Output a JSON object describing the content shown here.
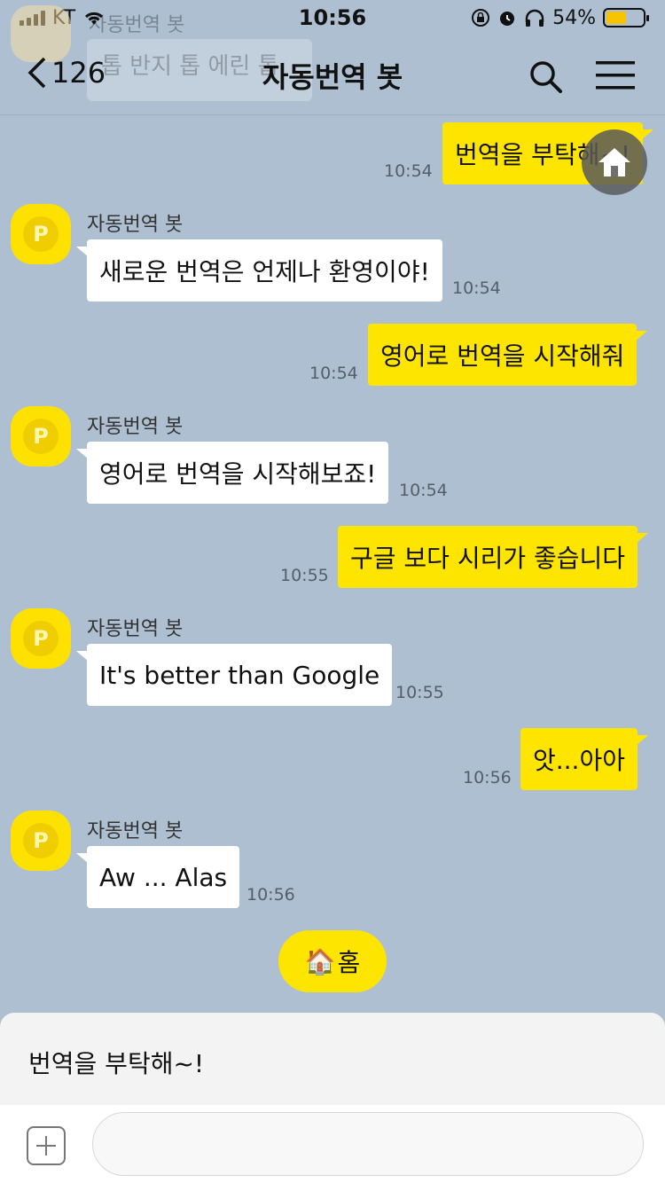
{
  "status_bar": {
    "carrier": "KT",
    "time": "10:56",
    "battery": "54%",
    "battery_level": 0.54
  },
  "header": {
    "back_count": "126",
    "title": "자동번역 봇",
    "ghost_notice": "톱 반지 톱 에린 톱",
    "ghost_sender": "자동번역 봇"
  },
  "messages": [
    {
      "from": "me",
      "text": "번역을 부탁해~!",
      "time": "10:54"
    },
    {
      "from": "bot",
      "sender": "자동번역 봇",
      "text": "새로운 번역은 언제나 환영이야!",
      "time": "10:54"
    },
    {
      "from": "me",
      "text": "영어로 번역을 시작해줘",
      "time": "10:54"
    },
    {
      "from": "bot",
      "sender": "자동번역 봇",
      "text": "영어로 번역을 시작해보죠!",
      "time": "10:54"
    },
    {
      "from": "me",
      "text": "구글 보다 시리가 좋습니다",
      "time": "10:55"
    },
    {
      "from": "bot",
      "sender": "자동번역 봇",
      "text": "It's better than Google",
      "time": "10:55"
    },
    {
      "from": "me",
      "text": "앗...아아",
      "time": "10:56"
    },
    {
      "from": "bot",
      "sender": "자동번역 봇",
      "text": "Aw ... Alas",
      "time": "10:56"
    }
  ],
  "home_chip": {
    "emoji": "🏠",
    "label": "홈"
  },
  "quick_reply": "번역을 부탁해~!",
  "input": {
    "placeholder": ""
  },
  "colors": {
    "background": "#aebfd1",
    "my_bubble": "#fee500",
    "bot_bubble": "#ffffff",
    "avatar": "#ffe100"
  }
}
